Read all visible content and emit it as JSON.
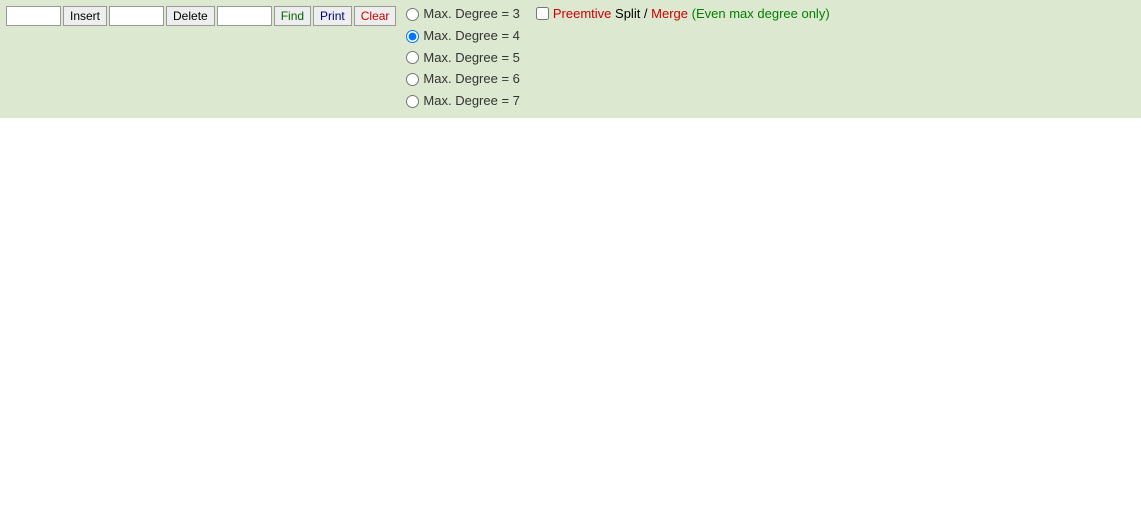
{
  "toolbar": {
    "insert_input_value": "",
    "insert_button_label": "Insert",
    "delete_input_value": "",
    "delete_button_label": "Delete",
    "find_input_value": "",
    "find_button_label": "Find",
    "print_button_label": "Print",
    "clear_button_label": "Clear"
  },
  "radio_group": {
    "options": [
      {
        "label": "Max. Degree = 3",
        "value": "3",
        "checked": false
      },
      {
        "label": "Max. Degree = 4",
        "value": "4",
        "checked": true
      },
      {
        "label": "Max. Degree = 5",
        "value": "5",
        "checked": false
      },
      {
        "label": "Max. Degree = 6",
        "value": "6",
        "checked": false
      },
      {
        "label": "Max. Degree = 7",
        "value": "7",
        "checked": false
      }
    ]
  },
  "preemptive": {
    "checked": false,
    "label_preemtive": "Preemtive",
    "label_split": " Split / ",
    "label_merge": "Merge",
    "label_even": " (Even max degree only)"
  }
}
